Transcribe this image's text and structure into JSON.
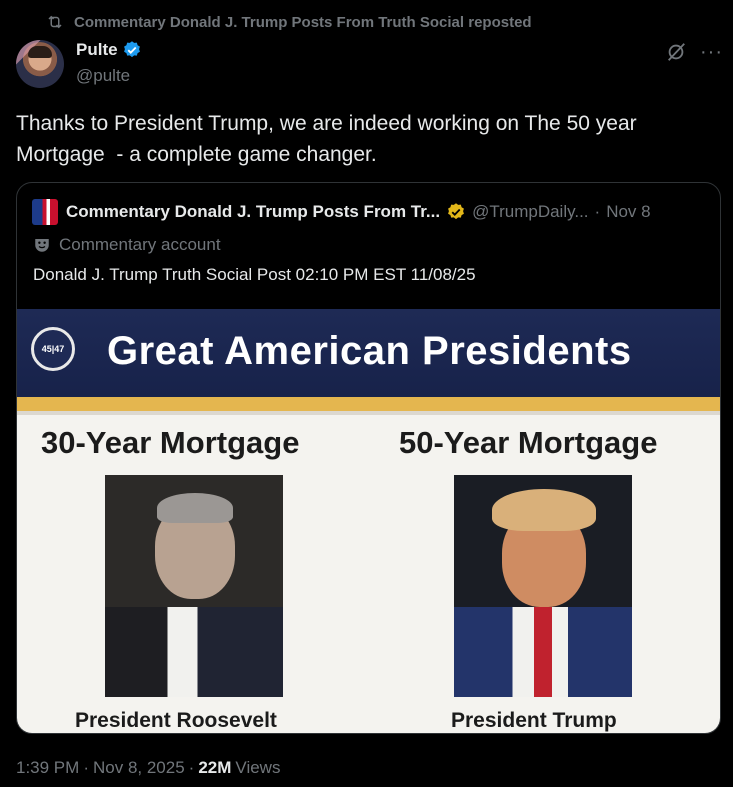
{
  "social_context": {
    "text": "Commentary Donald J. Trump Posts From Truth Social reposted"
  },
  "author": {
    "display_name": "Pulte",
    "handle": "@pulte",
    "verified": true
  },
  "post": {
    "text": "Thanks to President Trump, we are indeed working on The 50 year\nMortgage  - a complete game changer."
  },
  "quote": {
    "display_name": "Commentary Donald J. Trump Posts From Tr...",
    "handle": "@TrumpDaily...",
    "separator": "·",
    "date": "Nov 8",
    "label": "Commentary account",
    "text": "Donald J. Trump Truth Social Post 02:10 PM EST 11/08/25",
    "image": {
      "seal_text": "45|47",
      "title": "Great American Presidents",
      "left_heading": "30-Year Mortgage",
      "right_heading": "50-Year Mortgage",
      "left_caption": "President Roosevelt",
      "right_caption": "President Trump"
    }
  },
  "meta": {
    "time": "1:39 PM",
    "sep1": "·",
    "date": "Nov 8, 2025",
    "sep2": "·",
    "views_count": "22M",
    "views_label": "Views"
  },
  "colors": {
    "background": "#000000",
    "text": "#e7e9ea",
    "muted": "#71767b",
    "verified_blue": "#1d9bf0",
    "gold_badge": "#e2b719",
    "banner_navy": "#1e2a55"
  },
  "icons": {
    "repost": "repost-icon",
    "verified": "verified-badge-icon",
    "grok": "grok-icon",
    "more": "more-icon",
    "commentary": "mask-icon"
  }
}
